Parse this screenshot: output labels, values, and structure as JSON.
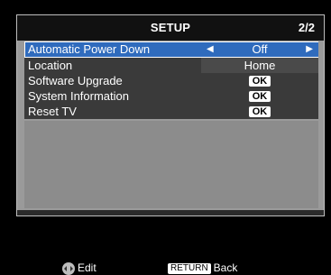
{
  "menu": {
    "title": "SETUP",
    "page_indicator": "2/2",
    "items": [
      {
        "label": "Automatic Power Down",
        "value": "Off",
        "type": "selector",
        "selected": true
      },
      {
        "label": "Location",
        "value": "Home",
        "type": "text"
      },
      {
        "label": "Software Upgrade",
        "value": "OK",
        "type": "ok"
      },
      {
        "label": "System Information",
        "value": "OK",
        "type": "ok"
      },
      {
        "label": "Reset TV",
        "value": "OK",
        "type": "ok"
      }
    ]
  },
  "footer": {
    "edit_label": "Edit",
    "return_key": "RETURN",
    "back_label": "Back"
  },
  "icons": {
    "left_arrow": "◀",
    "right_arrow": "▶"
  },
  "colors": {
    "selection": "#2f6bbd",
    "menu_bg": "#9a9a9a",
    "header_bg": "#111111"
  }
}
